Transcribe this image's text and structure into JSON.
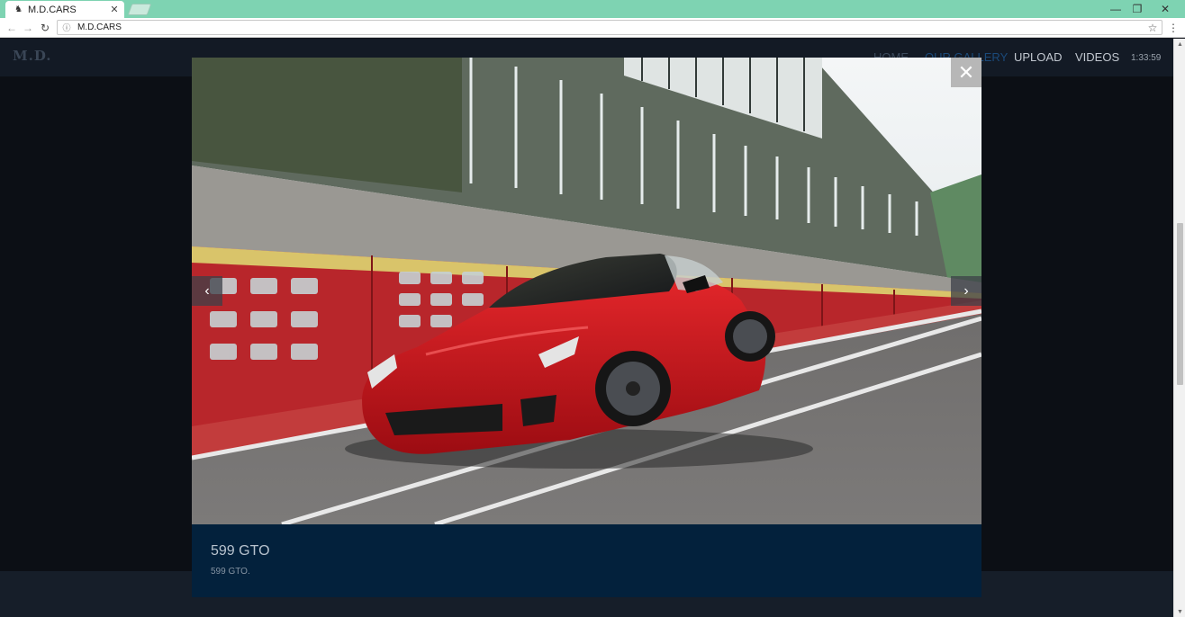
{
  "browser": {
    "tab_title": "M.D.CARS",
    "tab_icon": "horse-icon",
    "tab_close": "✕",
    "url": "M.D.CARS",
    "window_controls": [
      "—",
      "❐",
      "✕"
    ]
  },
  "site": {
    "logo": "M.D.",
    "nav": [
      {
        "label": "HOME"
      },
      {
        "label": "OUR GALLERY"
      },
      {
        "label": "UPLOAD"
      },
      {
        "label": "VIDEOS"
      }
    ],
    "clock": "1:33:59"
  },
  "lightbox": {
    "close_symbol": "✕",
    "prev_symbol": "‹",
    "next_symbol": "›",
    "caption_title": "599 GTO",
    "caption_description": "599 GTO.",
    "accent_color": "#03213c"
  }
}
